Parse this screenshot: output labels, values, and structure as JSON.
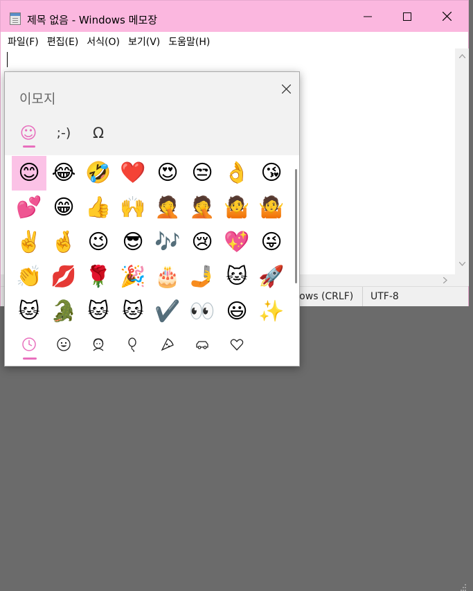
{
  "notepad": {
    "title": "제목 없음 - Windows 메모장",
    "menu": [
      "파일(F)",
      "편집(E)",
      "서식(O)",
      "보기(V)",
      "도움말(H)"
    ],
    "status": {
      "line_ending": "Windows (CRLF)",
      "encoding": "UTF-8"
    },
    "colors": {
      "titlebar": "#fbb7df"
    }
  },
  "emoji_panel": {
    "title": "이모지",
    "tabs": [
      {
        "name": "emoji",
        "label": "☺",
        "selected": true
      },
      {
        "name": "kaomoji",
        "label": ";-)"
      },
      {
        "name": "symbols",
        "label": "Ω"
      }
    ],
    "grid": [
      [
        "😊",
        "😂",
        "🤣",
        "❤️",
        "😍",
        "😒",
        "👌",
        "😘"
      ],
      [
        "💕",
        "😁",
        "👍",
        "🙌",
        "🤦",
        "🤦",
        "🤷",
        "🤷"
      ],
      [
        "✌️",
        "🤞",
        "😉",
        "😎",
        "🎶",
        "😢",
        "💖",
        "😜"
      ],
      [
        "👏",
        "💋",
        "🌹",
        "🎉",
        "🎂",
        "🤳",
        "🐱",
        "🚀"
      ],
      [
        "🐱",
        "🐊",
        "🐱",
        "🐱",
        "✔️",
        "👀",
        "😃",
        "✨"
      ]
    ],
    "selected_emoji": "😊",
    "categories": [
      "recent-clock-icon",
      "smiley-icon",
      "person-icon",
      "balloon-icon",
      "pizza-icon",
      "car-icon",
      "heart-icon"
    ],
    "accent": "#e86fbd"
  }
}
